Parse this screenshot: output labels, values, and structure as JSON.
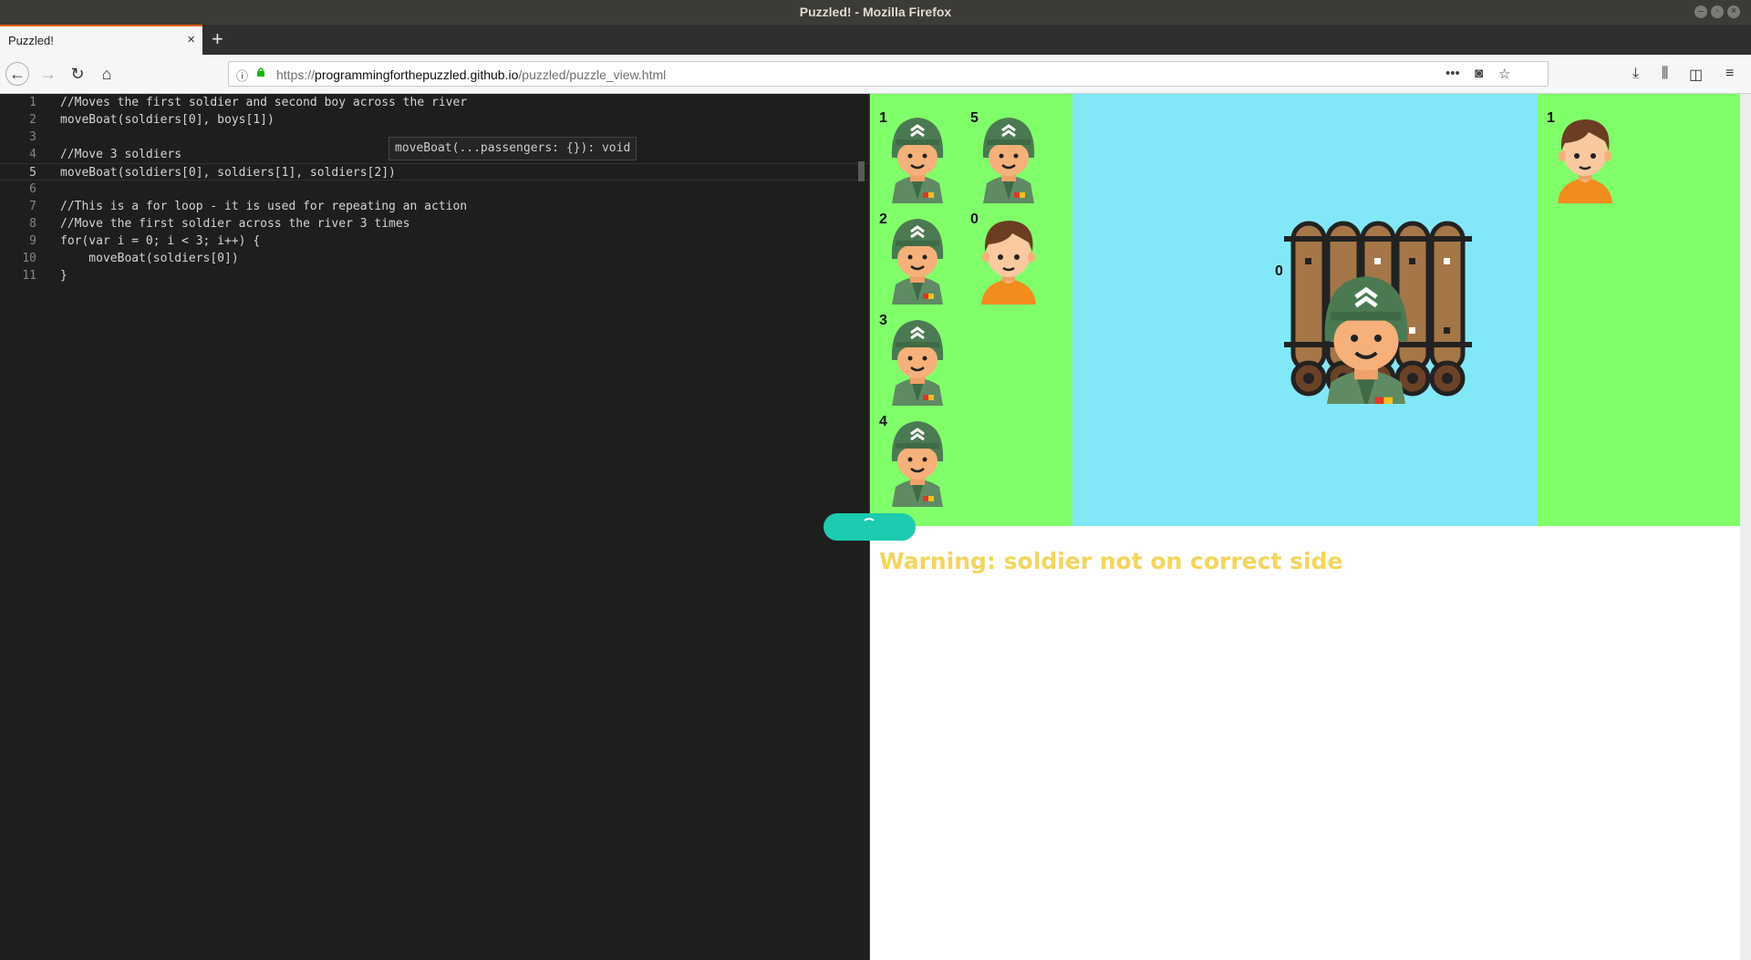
{
  "window": {
    "title": "Puzzled! - Mozilla Firefox"
  },
  "tabs": [
    {
      "label": "Puzzled!"
    }
  ],
  "nav": {
    "url_prefix": "https://",
    "url_domain": "programmingforthepuzzled.github.io",
    "url_path": "/puzzled/puzzle_view.html"
  },
  "editor": {
    "lines": [
      {
        "n": "1",
        "text": "//Moves the first soldier and second boy across the river"
      },
      {
        "n": "2",
        "text": "moveBoat(soldiers[0], boys[1])"
      },
      {
        "n": "3",
        "text": ""
      },
      {
        "n": "4",
        "text": "//Move 3 soldiers"
      },
      {
        "n": "5",
        "text": "moveBoat(soldiers[0], soldiers[1], soldiers[2])"
      },
      {
        "n": "6",
        "text": ""
      },
      {
        "n": "7",
        "text": "//This is a for loop - it is used for repeating an action"
      },
      {
        "n": "8",
        "text": "//Move the first soldier across the river 3 times"
      },
      {
        "n": "9",
        "text": "for(var i = 0; i < 3; i++) {"
      },
      {
        "n": "10",
        "text": "    moveBoat(soldiers[0])"
      },
      {
        "n": "11",
        "text": "}"
      }
    ],
    "tooltip": "moveBoat(...passengers: {}): void"
  },
  "game": {
    "left_bank": [
      {
        "type": "soldier",
        "label": "1"
      },
      {
        "type": "soldier",
        "label": "5"
      },
      {
        "type": "soldier",
        "label": "2"
      },
      {
        "type": "boy",
        "label": "0"
      },
      {
        "type": "soldier",
        "label": "3"
      },
      {
        "type": "soldier",
        "label": "4"
      }
    ],
    "boat": {
      "passengers": [
        {
          "type": "soldier",
          "label": "0"
        }
      ]
    },
    "right_bank": [
      {
        "type": "boy",
        "label": "1"
      }
    ],
    "warning": "Warning: soldier not on correct side",
    "colors": {
      "grass": "#80ff6a",
      "river": "#82e8f7",
      "warning": "#f5d55c",
      "run_button": "#1ccbb0"
    }
  }
}
